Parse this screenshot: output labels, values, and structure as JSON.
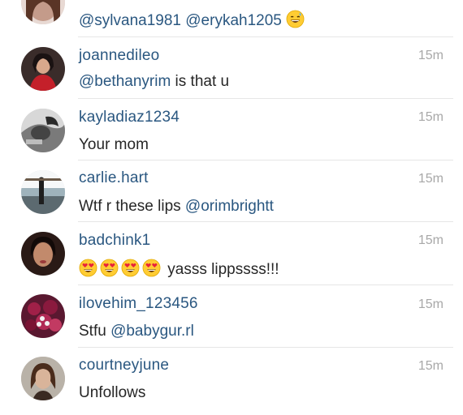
{
  "comments": [
    {
      "username": "",
      "time": "",
      "text_mentions": [
        "@sylvana1981",
        "@erykah1205"
      ],
      "emoji": "sweat-smile-emoji",
      "avatar": "partial-avatar"
    },
    {
      "username": "joannedileo",
      "time": "15m",
      "mention": "@bethanyrim",
      "text_after": " is that u",
      "avatar": "woman-red-top-avatar"
    },
    {
      "username": "kayladiaz1234",
      "time": "15m",
      "text": "Your mom",
      "avatar": "bw-photo-avatar"
    },
    {
      "username": "carlie.hart",
      "time": "15m",
      "text_before": "Wtf r these lips ",
      "mention": "@orimbrightt",
      "avatar": "beach-avatar"
    },
    {
      "username": "badchink1",
      "time": "15m",
      "emoji_count": 4,
      "emoji": "heart-eyes-emoji",
      "text": " yasss lippssss!!!",
      "avatar": "woman-portrait-avatar"
    },
    {
      "username": "ilovehim_123456",
      "time": "15m",
      "text_before": "Stfu ",
      "mention": "@babygur.rl",
      "avatar": "flowers-avatar"
    },
    {
      "username": "courtneyjune",
      "time": "15m",
      "text": "Unfollows",
      "avatar": "woman-selfie-avatar"
    }
  ],
  "colors": {
    "username": "#2a5780",
    "text": "#262626",
    "time": "#a8a8a8",
    "divider": "#e6e6e6"
  }
}
